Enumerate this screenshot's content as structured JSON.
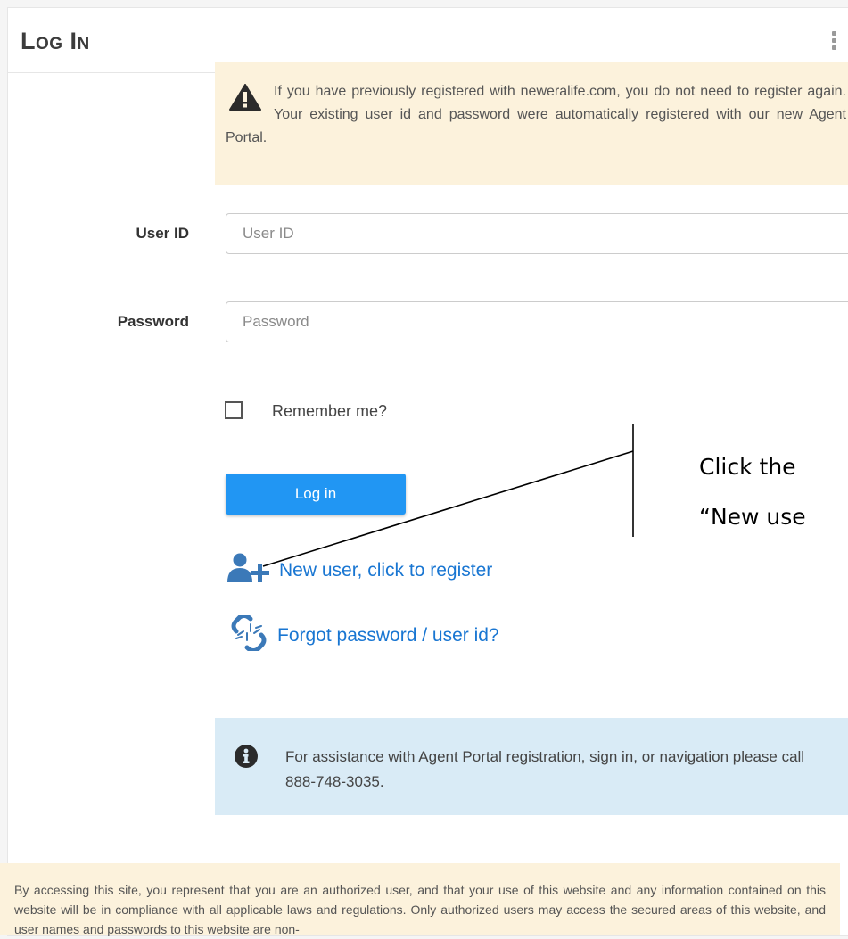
{
  "header": {
    "title": "Log In"
  },
  "warning": {
    "text": "If you have previously registered with neweralife.com, you do not need to register again. Your existing user id and password were automatically registered with our new Agent Portal."
  },
  "form": {
    "user_id": {
      "label": "User ID",
      "placeholder": "User ID",
      "value": ""
    },
    "password": {
      "label": "Password",
      "placeholder": "Password",
      "value": ""
    },
    "remember_label": "Remember me?",
    "login_label": "Log in"
  },
  "links": {
    "register": {
      "label": "New user, click to register",
      "icon": "add-user-icon"
    },
    "forgot": {
      "label": "Forgot password / user id?",
      "icon": "broken-link-icon"
    }
  },
  "annotation": {
    "line1": "Click the",
    "line2": "“New use"
  },
  "info": {
    "text": "For assistance with Agent Portal registration, sign in, or navigation please call 888-748-3035."
  },
  "disclaimer": {
    "text": "By accessing this site, you represent that you are an authorized user, and that your use of this website and any information contained on this website will be in compliance with all applicable laws and regulations. Only authorized users may access the secured areas of this website, and user names and passwords to this website are non-"
  },
  "colors": {
    "accent": "#2196f3",
    "link": "#1976d2",
    "warning_bg": "#fcf2dc",
    "info_bg": "#d9ebf6"
  }
}
